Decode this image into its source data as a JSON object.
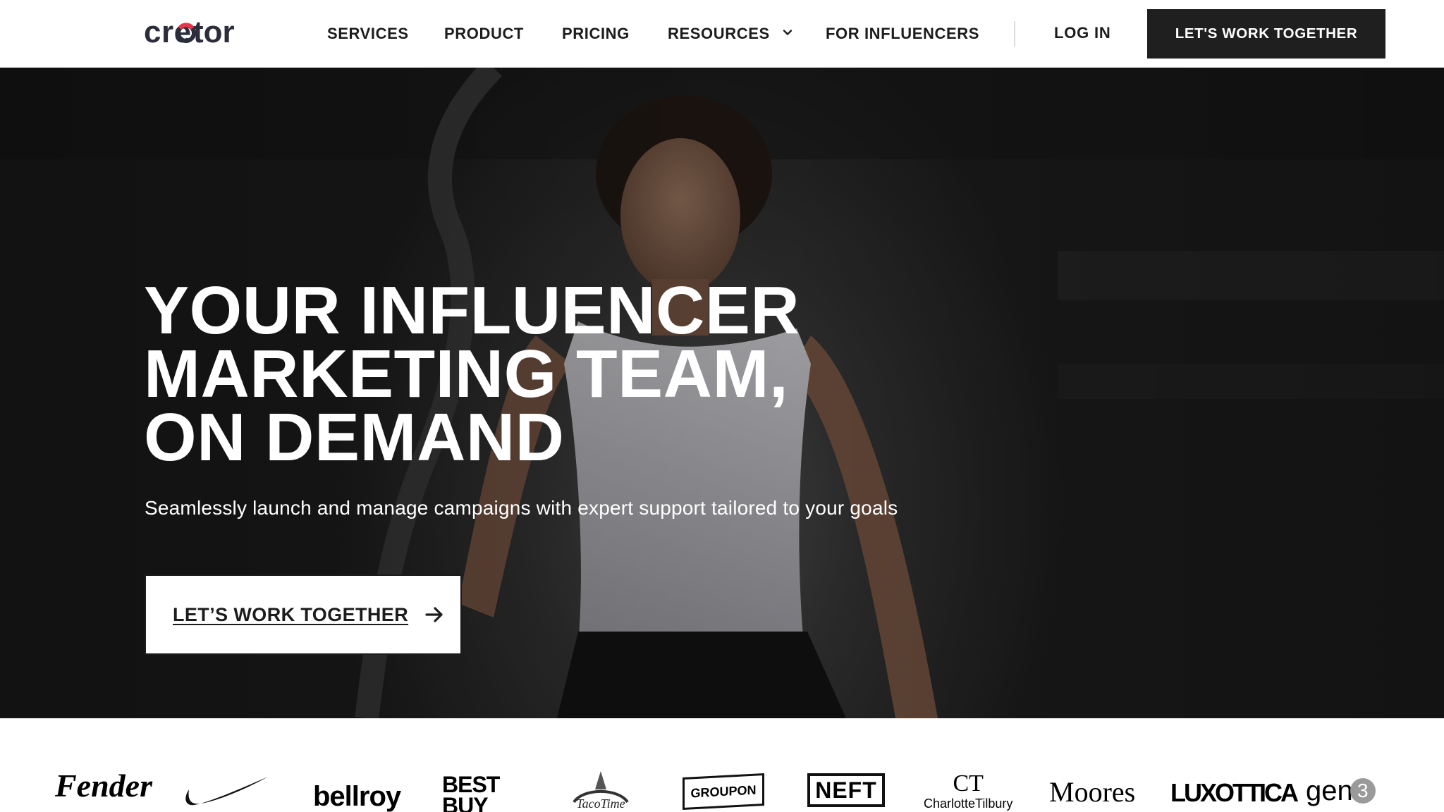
{
  "header": {
    "logo_text": "creator",
    "nav": {
      "services": "SERVICES",
      "product": "PRODUCT",
      "pricing": "PRICING",
      "resources": "RESOURCES",
      "influencers": "FOR INFLUENCERS"
    },
    "login": "LOG IN",
    "cta": "LET'S WORK TOGETHER"
  },
  "hero": {
    "title_lines": [
      "YOUR INFLUENCER",
      "MARKETING TEAM,",
      "ON DEMAND"
    ],
    "subtitle": "Seamlessly launch and manage campaigns with expert support tailored to your goals",
    "cta": "LET’S WORK TOGETHER"
  },
  "brands": {
    "fender": "Fender",
    "nike": "nike-swoosh-logo",
    "bellroy": "bellroy",
    "bestbuy_1": "BEST",
    "bestbuy_2": "BUY",
    "tacotime": "TacoTime",
    "groupon": "GROUPON",
    "neft": "NEFT",
    "charlotte_mark": "CT",
    "charlotte_name": "CharlotteTilbury",
    "moores": "Moores",
    "luxottica": "LUXOTTICA",
    "gen3_text": "gen",
    "gen3_num": "3"
  },
  "colors": {
    "logo_dark": "#2b2d3a",
    "logo_accent": "#e8344e",
    "cta_dark": "#1f1f1f",
    "text_dark": "#1c1c1c"
  }
}
